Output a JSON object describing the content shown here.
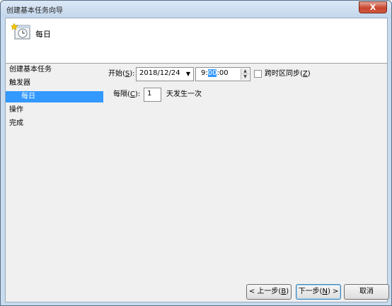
{
  "window": {
    "title": "创建基本任务向导",
    "close_glyph": "X"
  },
  "header": {
    "icon": "calendar-clock-icon",
    "title": "每日"
  },
  "nav": {
    "items": [
      {
        "label": "创建基本任务",
        "selected": false
      },
      {
        "label": "触发器",
        "selected": false
      },
      {
        "label": "每日",
        "selected": true
      },
      {
        "label": "操作",
        "selected": false
      },
      {
        "label": "完成",
        "selected": false
      }
    ]
  },
  "trigger": {
    "start_label": "开始(",
    "start_key": "S",
    "start_suffix": "):",
    "date_value": "2018/12/24",
    "time_prefix": "9:",
    "time_selected": "00",
    "time_suffix": ":00",
    "sync_label": "跨时区同步(",
    "sync_key": "Z",
    "sync_suffix": ")",
    "sync_checked": false,
    "recur_label": "每隔(",
    "recur_key": "C",
    "recur_suffix": "):",
    "recur_value": "1",
    "recur_unit": "天发生一次"
  },
  "buttons": {
    "back": {
      "prefix": "< 上一步(",
      "key": "B",
      "suffix": ")"
    },
    "next": {
      "prefix": "下一步(",
      "key": "N",
      "suffix": ") >"
    },
    "cancel": "取消"
  }
}
